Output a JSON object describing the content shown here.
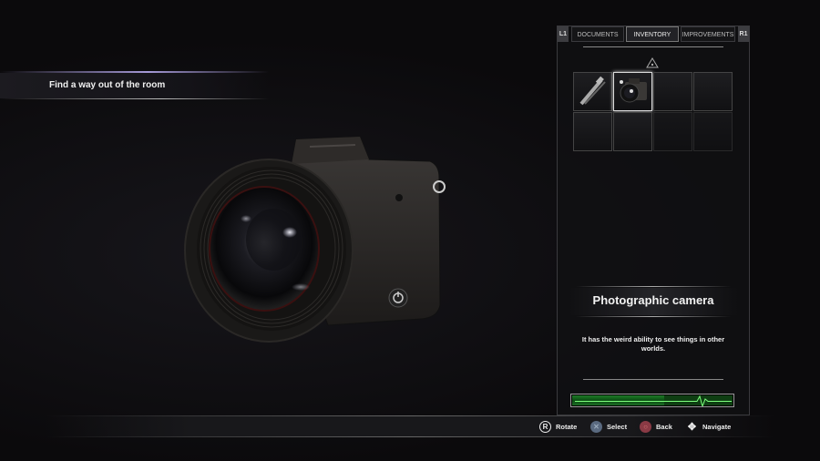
{
  "objective": {
    "text": "Find a way out of the room"
  },
  "tabs": {
    "left_key": "L1",
    "right_key": "R1",
    "items": [
      {
        "label": "DOCUMENTS",
        "active": false
      },
      {
        "label": "INVENTORY",
        "active": true
      },
      {
        "label": "IMPROVEMENTS",
        "active": false
      }
    ]
  },
  "inventory": {
    "slots": [
      {
        "item": "lockpick-tool",
        "selected": false
      },
      {
        "item": "photographic-camera",
        "selected": true
      },
      {
        "item": "",
        "selected": false
      },
      {
        "item": "",
        "selected": false
      },
      {
        "item": "",
        "selected": false
      },
      {
        "item": "",
        "selected": false
      },
      {
        "item": "",
        "selected": false
      },
      {
        "item": "",
        "selected": false
      }
    ]
  },
  "item": {
    "name": "Photographic camera",
    "description": "It has the weird ability to see things in other worlds."
  },
  "health": {
    "level": 0.57,
    "color": "#1e7a28"
  },
  "controls": [
    {
      "button": "R",
      "label": "Rotate"
    },
    {
      "button": "cross",
      "label": "Select"
    },
    {
      "button": "circle",
      "label": "Back"
    },
    {
      "button": "dpad",
      "label": "Navigate"
    }
  ]
}
